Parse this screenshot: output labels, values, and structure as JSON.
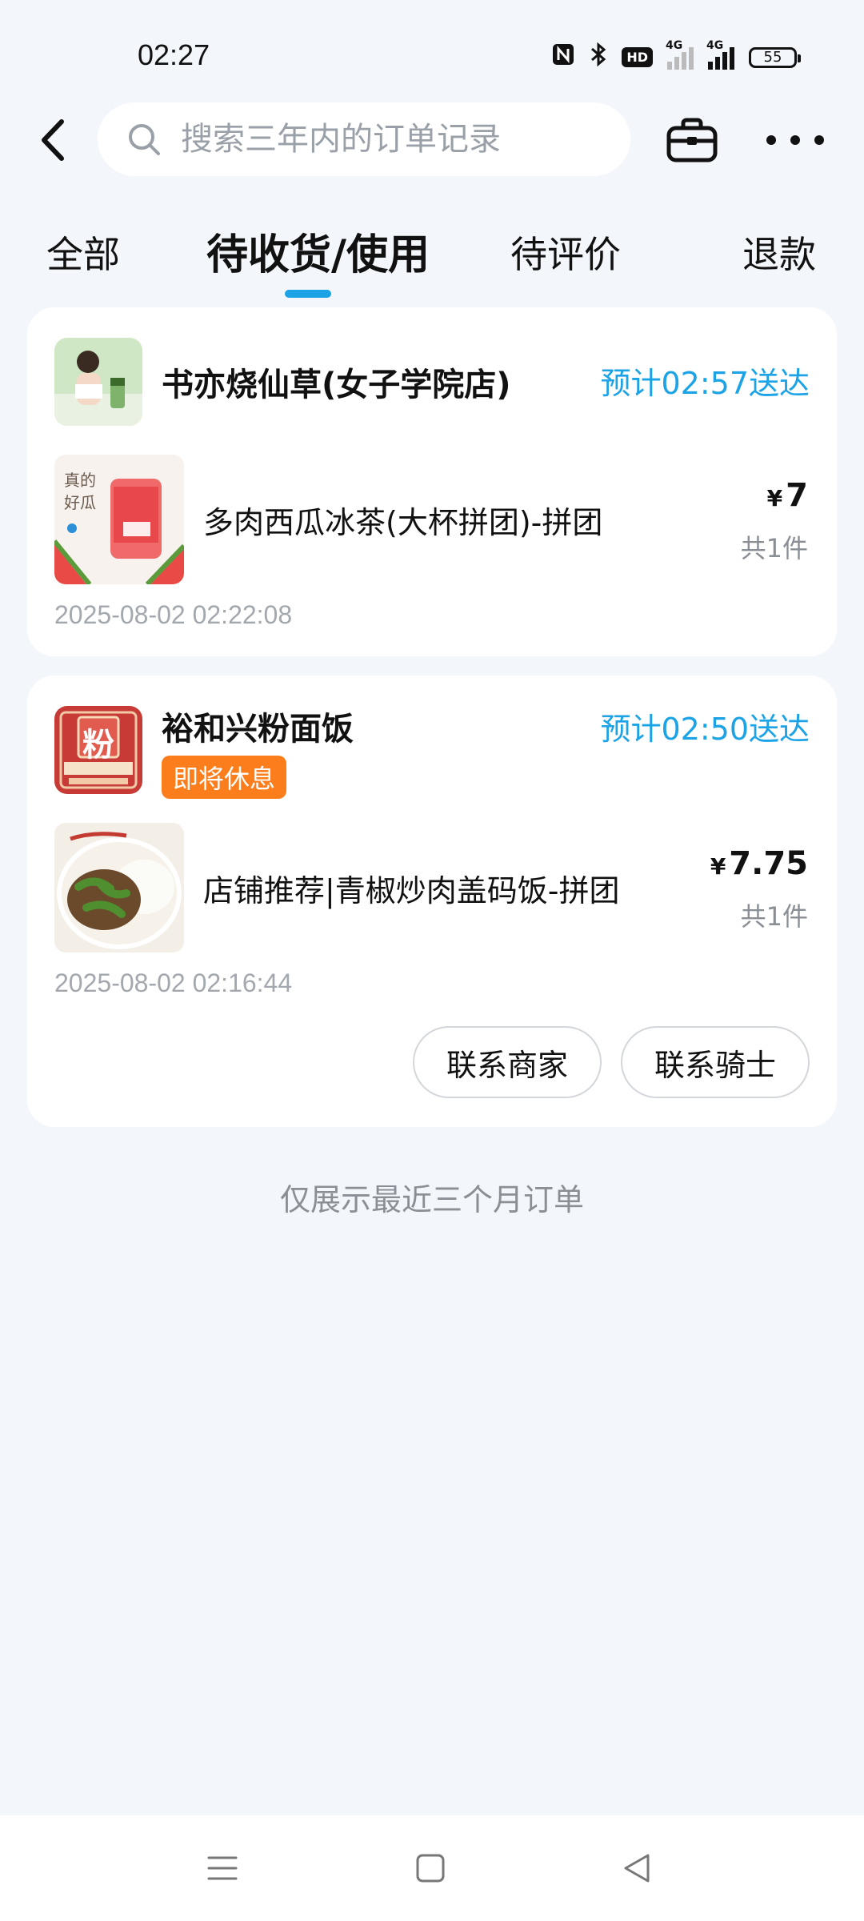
{
  "status_bar": {
    "time": "02:27",
    "hd_label": "HD",
    "network_1": "4G",
    "network_2": "4G",
    "battery": "55",
    "icons": [
      "nfc-icon",
      "bluetooth-icon",
      "hd-icon",
      "signal-icon",
      "signal-icon",
      "battery-icon"
    ]
  },
  "header": {
    "search_placeholder": "搜索三年内的订单记录",
    "icons": [
      "back-icon",
      "search-icon",
      "toolbox-icon",
      "more-icon"
    ]
  },
  "tabs": [
    {
      "label": "全部",
      "active": false
    },
    {
      "label": "待收货/使用",
      "active": true
    },
    {
      "label": "待评价",
      "active": false
    },
    {
      "label": "退款",
      "active": false
    }
  ],
  "orders": [
    {
      "shop_name": "书亦烧仙草(女子学院店)",
      "eta": "预计02:57送达",
      "item_name": "多肉西瓜冰茶(大杯拼团)-拼团",
      "currency": "¥",
      "price": "7",
      "quantity": "共1件",
      "order_time": "2025-08-02 02:22:08",
      "thumb_text": "真的好瓜"
    },
    {
      "shop_name": "裕和兴粉面饭",
      "status_badge": "即将休息",
      "eta": "预计02:50送达",
      "item_name": "店铺推荐|青椒炒肉盖码饭-拼团",
      "currency": "¥",
      "price": "7.75",
      "quantity": "共1件",
      "order_time": "2025-08-02 02:16:44",
      "logo_text": "粉",
      "buttons": [
        "联系商家",
        "联系骑士"
      ]
    }
  ],
  "footer_note": "仅展示最近三个月订单",
  "colors": {
    "accent": "#1ba3e6",
    "badge_orange": "#fb7d1b",
    "background": "#f3f6fa"
  }
}
